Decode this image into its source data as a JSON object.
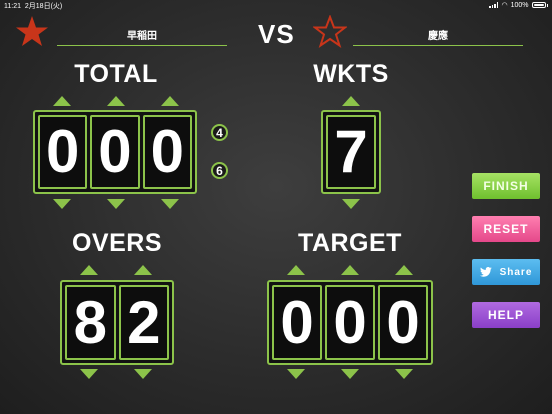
{
  "status_bar": {
    "time": "11:21",
    "date": "2月18日(火)",
    "battery": "100%"
  },
  "header": {
    "home_team": "早稲田",
    "away_team": "慶應",
    "vs": "VS",
    "home_star_color": "#c8351a",
    "away_star_color": "#c8351a"
  },
  "total": {
    "label": "TOTAL",
    "digits": [
      "0",
      "0",
      "0"
    ],
    "quick_add": [
      "4",
      "6"
    ]
  },
  "wkts": {
    "label": "WKTS",
    "digits": [
      "7"
    ]
  },
  "overs": {
    "label": "OVERS",
    "digits": [
      "8",
      "2"
    ]
  },
  "target": {
    "label": "TARGET",
    "digits": [
      "0",
      "0",
      "0"
    ]
  },
  "buttons": {
    "finish": "FINISH",
    "reset": "RESET",
    "share": "Share",
    "help": "HELP"
  },
  "colors": {
    "accent": "#8cc34a",
    "finish": "#8ad14a",
    "reset": "#f0609c",
    "share": "#3aa5e2",
    "help": "#9d55d4"
  }
}
